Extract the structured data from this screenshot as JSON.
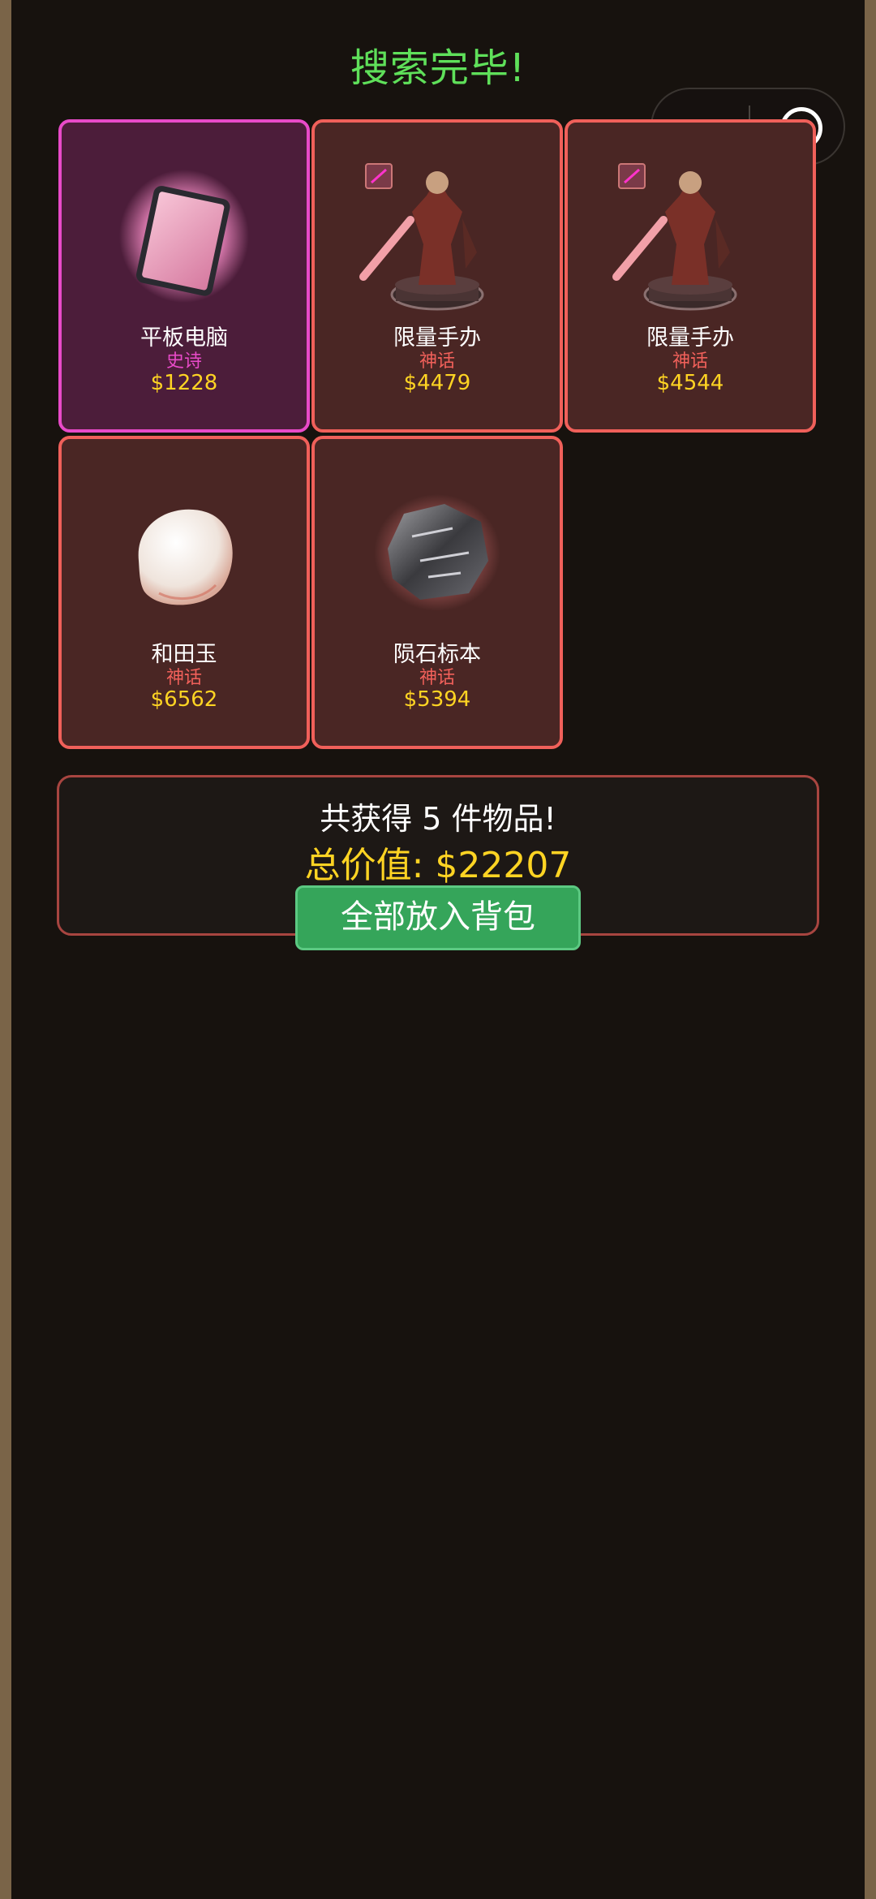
{
  "header": {
    "title": "搜索完毕!"
  },
  "capsule": {
    "more_icon": "more-dots-icon",
    "close_icon": "record-target-icon"
  },
  "items": [
    {
      "name": "平板电脑",
      "rarity": "史诗",
      "price": "$1228",
      "icon": "tablet-icon",
      "rarity_color": "#e84ac8"
    },
    {
      "name": "限量手办",
      "rarity": "神话",
      "price": "$4479",
      "icon": "figure-icon",
      "rarity_color": "#f0605a"
    },
    {
      "name": "限量手办",
      "rarity": "神话",
      "price": "$4544",
      "icon": "figure-icon",
      "rarity_color": "#f0605a"
    },
    {
      "name": "和田玉",
      "rarity": "神话",
      "price": "$6562",
      "icon": "jade-icon",
      "rarity_color": "#f0605a"
    },
    {
      "name": "陨石标本",
      "rarity": "神话",
      "price": "$5394",
      "icon": "meteorite-icon",
      "rarity_color": "#f0605a"
    }
  ],
  "summary": {
    "count_text": "共获得 5 件物品!",
    "total_text": "总价值: $22207",
    "button_label": "全部放入背包"
  },
  "colors": {
    "title": "#5fe05a",
    "price": "#ffd423",
    "button": "#35a55a",
    "background": "#17120e"
  }
}
